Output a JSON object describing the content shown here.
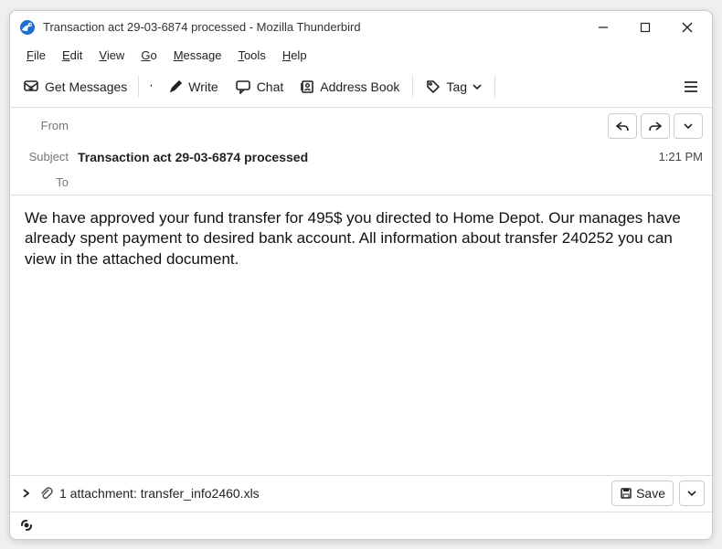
{
  "window": {
    "title": "Transaction act 29-03-6874 processed - Mozilla Thunderbird"
  },
  "menubar": [
    {
      "u": "F",
      "rest": "ile"
    },
    {
      "u": "E",
      "rest": "dit"
    },
    {
      "u": "V",
      "rest": "iew"
    },
    {
      "u": "G",
      "rest": "o"
    },
    {
      "u": "M",
      "rest": "essage"
    },
    {
      "u": "T",
      "rest": "ools"
    },
    {
      "u": "H",
      "rest": "elp"
    }
  ],
  "toolbar": {
    "get_messages": "Get Messages",
    "write": "Write",
    "chat": "Chat",
    "address_book": "Address Book",
    "tag": "Tag"
  },
  "headers": {
    "from_label": "From",
    "from_value": "",
    "subject_label": "Subject",
    "subject_value": "Transaction act 29-03-6874 processed",
    "time": "1:21 PM",
    "to_label": "To",
    "to_value": ""
  },
  "email_body": "We have approved your fund transfer for 495$ you directed to Home Depot. Our manages have already spent payment to desired bank account. All information about transfer 240252 you can view in the attached document.",
  "attachment": {
    "summary": "1 attachment: transfer_info2460.xls",
    "save": "Save"
  }
}
